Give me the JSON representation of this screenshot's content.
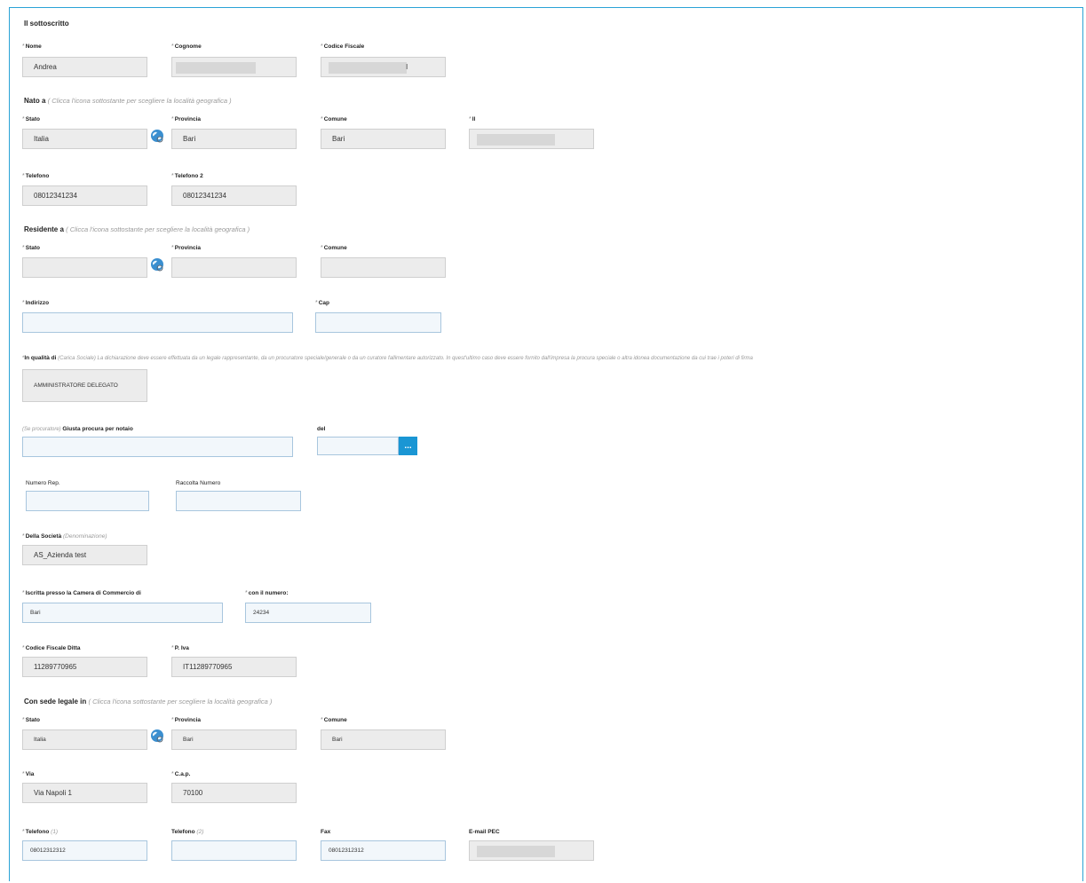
{
  "title": "Il sottoscritto",
  "personal": {
    "nome": {
      "label": "Nome",
      "value": "Andrea"
    },
    "cognome": {
      "label": "Cognome",
      "value": ""
    },
    "codice_fiscale": {
      "label": "Codice Fiscale",
      "value": "l"
    }
  },
  "nato_a": {
    "heading": "Nato a",
    "hint": "( Clicca l'icona sottostante per scegliere la località geografica )",
    "stato": {
      "label": "Stato",
      "value": "Italia"
    },
    "provincia": {
      "label": "Provincia",
      "value": "Bari"
    },
    "comune": {
      "label": "Comune",
      "value": "Bari"
    },
    "il": {
      "label": "Il",
      "value": ""
    }
  },
  "telefoni": {
    "telefono": {
      "label": "Telefono",
      "value": "08012341234"
    },
    "telefono2": {
      "label": "Telefono 2",
      "value": "08012341234"
    }
  },
  "residente_a": {
    "heading": "Residente a",
    "hint": "( Clicca l'icona sottostante per scegliere la località geografica )",
    "stato": {
      "label": "Stato",
      "value": ""
    },
    "provincia": {
      "label": "Provincia",
      "value": ""
    },
    "comune": {
      "label": "Comune",
      "value": ""
    }
  },
  "indirizzo": {
    "label": "Indirizzo",
    "value": ""
  },
  "cap": {
    "label": "Cap",
    "value": ""
  },
  "qualita": {
    "label": "In qualità di",
    "note": "(Carica Sociale) La dichiarazione deve essere effettuata da un legale rappresentante, da un procuratore speciale/generale o da un curatore fallimentare autorizzato. In quest'ultimo caso deve essere fornito dall'impresa la procura speciale o altra idonea documentazione da cui trae i poteri di firma",
    "value": "AMMINISTRATORE DELEGATO"
  },
  "procura": {
    "prefix": "(Se procuratore)",
    "label": "Giusta procura per notaio",
    "value": "",
    "del_label": "del",
    "del_value": "",
    "cal_button": "..."
  },
  "numero_rep": {
    "label": "Numero Rep.",
    "value": ""
  },
  "raccolta_numero": {
    "label": "Raccolta Numero",
    "value": ""
  },
  "societa": {
    "label": "Della Società",
    "hint": "(Denominazione)",
    "value": "AS_Azienda test"
  },
  "camera": {
    "iscritta": {
      "label": "Iscritta presso la Camera di Commercio di",
      "value": "Bari"
    },
    "numero": {
      "label": "con il numero:",
      "value": "24234"
    }
  },
  "ditta": {
    "cf": {
      "label": "Codice Fiscale Ditta",
      "value": "11289770965"
    },
    "piva": {
      "label": "P. Iva",
      "value": "IT11289770965"
    }
  },
  "sede": {
    "heading": "Con sede legale in",
    "hint": "( Clicca l'icona sottostante per scegliere la località geografica )",
    "stato": {
      "label": "Stato",
      "value": "Italia"
    },
    "provincia": {
      "label": "Provincia",
      "value": "Bari"
    },
    "comune": {
      "label": "Comune",
      "value": "Bari"
    }
  },
  "via": {
    "label": "Via",
    "value": "Via Napoli 1"
  },
  "cap2": {
    "label": "C.a.p.",
    "value": "70100"
  },
  "contatti": {
    "tel1": {
      "label": "Telefono",
      "hint": "(1)",
      "value": "08012312312"
    },
    "tel2": {
      "label": "Telefono",
      "hint": "(2)",
      "value": ""
    },
    "fax": {
      "label": "Fax",
      "value": "08012312312"
    },
    "pec": {
      "label": "E-mail PEC",
      "value": ""
    }
  },
  "required_mark": "*",
  "colors": {
    "accent": "#1a96d4",
    "frame": "#2aa3d6",
    "readonly_bg": "#ececec",
    "editable_bg": "#f2f7fb"
  }
}
